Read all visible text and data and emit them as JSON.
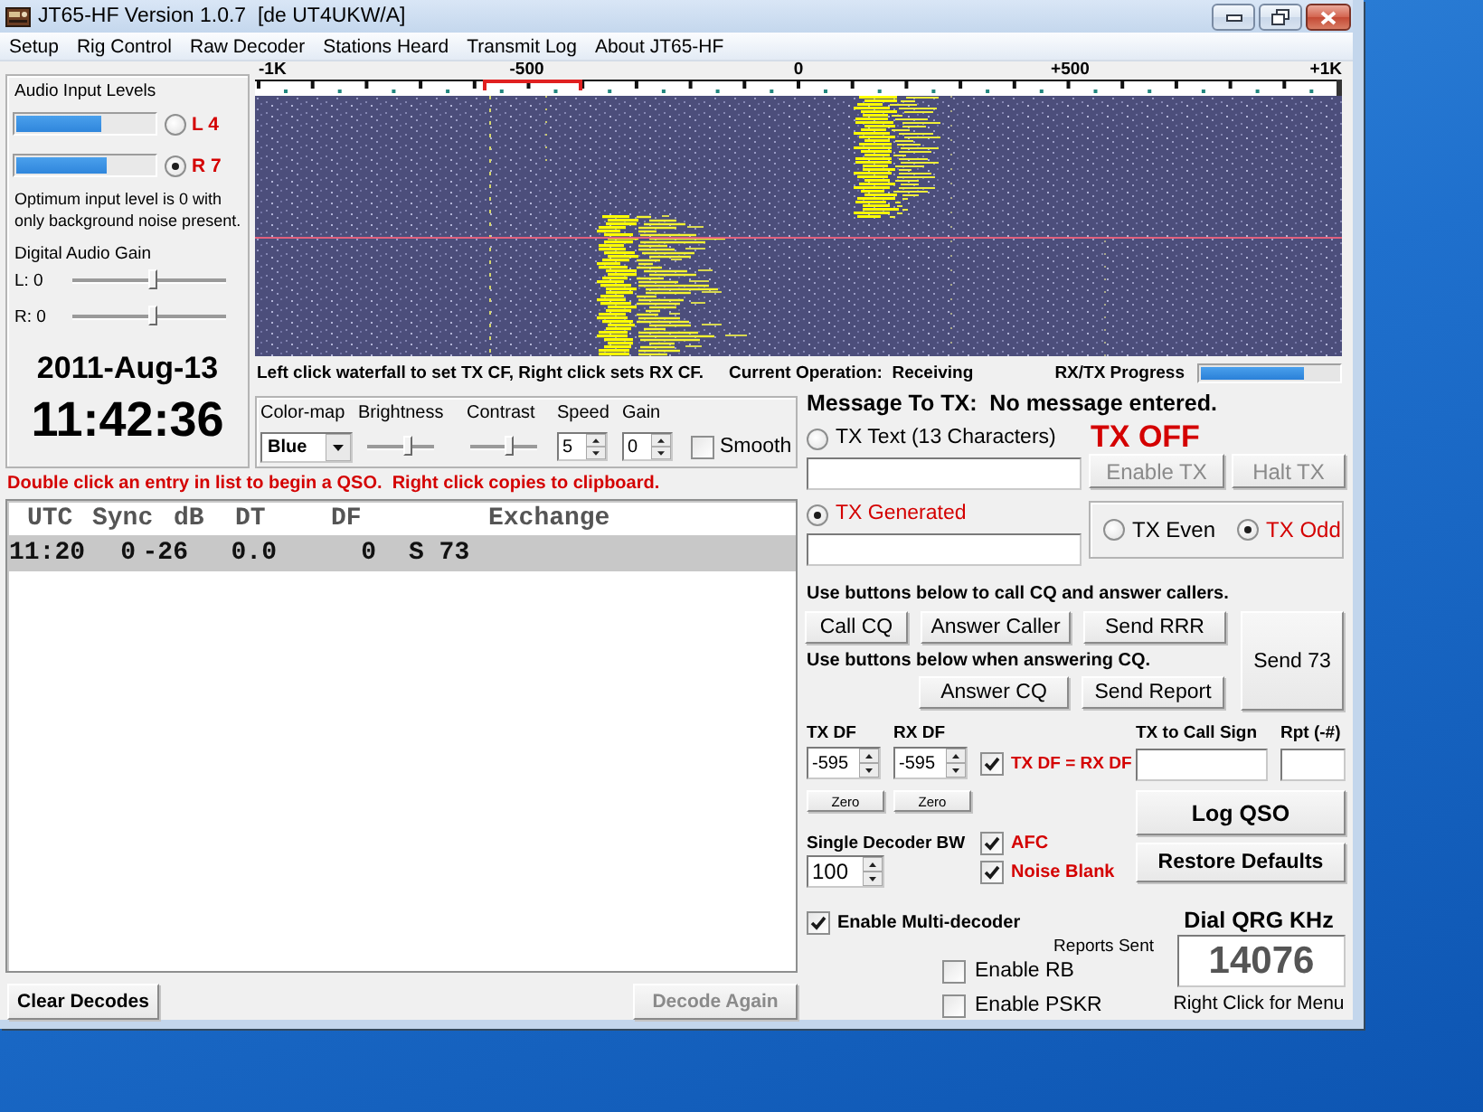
{
  "window": {
    "title": "JT65-HF Version 1.0.7  [de UT4UKW/A]"
  },
  "menu": [
    "Setup",
    "Rig Control",
    "Raw Decoder",
    "Stations Heard",
    "Transmit Log",
    "About JT65-HF"
  ],
  "audio": {
    "title": "Audio Input Levels",
    "channels": [
      {
        "label": "L 4",
        "level": 0.62,
        "selected": false
      },
      {
        "label": "R 7",
        "level": 0.66,
        "selected": true
      }
    ],
    "hint": "Optimum input level is 0 with only background noise present.",
    "gain_title": "Digital Audio Gain",
    "gains": [
      {
        "label": "L: 0",
        "level": 0.52
      },
      {
        "label": "R: 0",
        "level": 0.52
      }
    ]
  },
  "clock": {
    "date": "2011-Aug-13",
    "time": "11:42:36"
  },
  "waterfall": {
    "scale": [
      "-1K",
      "-500",
      "0",
      "+500",
      "+1K"
    ],
    "hint": "Left click waterfall to set TX CF, Right click sets RX CF.",
    "operation": "Current Operation:  Receiving",
    "progress": {
      "label": "RX/TX Progress",
      "level": 0.75
    }
  },
  "display": {
    "color_map": {
      "label": "Color-map",
      "value": "Blue"
    },
    "brightness": {
      "label": "Brightness",
      "level": 0.6
    },
    "contrast": {
      "label": "Contrast",
      "level": 0.57
    },
    "speed": {
      "label": "Speed",
      "value": "5"
    },
    "gain": {
      "label": "Gain",
      "value": "0"
    },
    "smooth": {
      "label": "Smooth",
      "checked": false
    }
  },
  "decode_hint": "Double click an entry in list to begin a QSO.  Right click copies to clipboard.",
  "decodes": {
    "columns": [
      "UTC",
      "Sync",
      "dB",
      "DT",
      "DF",
      "Exchange"
    ],
    "rows": [
      {
        "selected": true,
        "cells": [
          "11:20",
          "0",
          "-26",
          "0.0",
          "0",
          "S 73"
        ]
      }
    ]
  },
  "decode_buttons": [
    {
      "label": "Clear Decodes",
      "disabled": false
    },
    {
      "label": "Decode Again",
      "disabled": true
    }
  ],
  "message": {
    "heading": "Message To TX:  No message entered.",
    "status": "TX OFF",
    "sources": [
      {
        "label": "TX Text (13 Characters)",
        "selected": false
      },
      {
        "label": "TX Generated",
        "selected": true
      }
    ],
    "tx_buttons": [
      {
        "label": "Enable TX",
        "disabled": true
      },
      {
        "label": "Halt TX",
        "disabled": true
      }
    ],
    "period": [
      {
        "label": "TX Even",
        "selected": false
      },
      {
        "label": "TX Odd",
        "selected": true
      }
    ]
  },
  "cq": {
    "hint": "Use buttons below to call CQ and answer callers.",
    "buttons": [
      "Call CQ",
      "Answer Caller",
      "Send RRR"
    ],
    "answer_hint": "Use buttons below when answering CQ.",
    "answer_buttons": [
      "Answer CQ",
      "Send Report"
    ],
    "send73": "Send 73"
  },
  "df": {
    "fields": [
      {
        "label": "TX DF",
        "value": "-595",
        "button": "Zero"
      },
      {
        "label": "RX DF",
        "value": "-595",
        "button": "Zero"
      }
    ],
    "lock": {
      "label": "TX DF = RX DF",
      "checked": true
    }
  },
  "callsign": {
    "fields": [
      "TX to Call Sign",
      "Rpt (-#)"
    ],
    "buttons": [
      "Log QSO",
      "Restore Defaults"
    ]
  },
  "bandwidth": {
    "label": "Single Decoder BW",
    "value": "100"
  },
  "options": [
    {
      "label": "AFC",
      "checked": true
    },
    {
      "label": "Noise Blank",
      "checked": true
    }
  ],
  "multi_decoder": {
    "label": "Enable Multi-decoder",
    "checked": true
  },
  "reports": {
    "title": "Reports Sent",
    "options": [
      {
        "label": "Enable RB",
        "checked": false
      },
      {
        "label": "Enable PSKR",
        "checked": false
      }
    ]
  },
  "dial": {
    "title": "Dial QRG KHz",
    "value": "14076",
    "hint": "Right Click for Menu"
  }
}
